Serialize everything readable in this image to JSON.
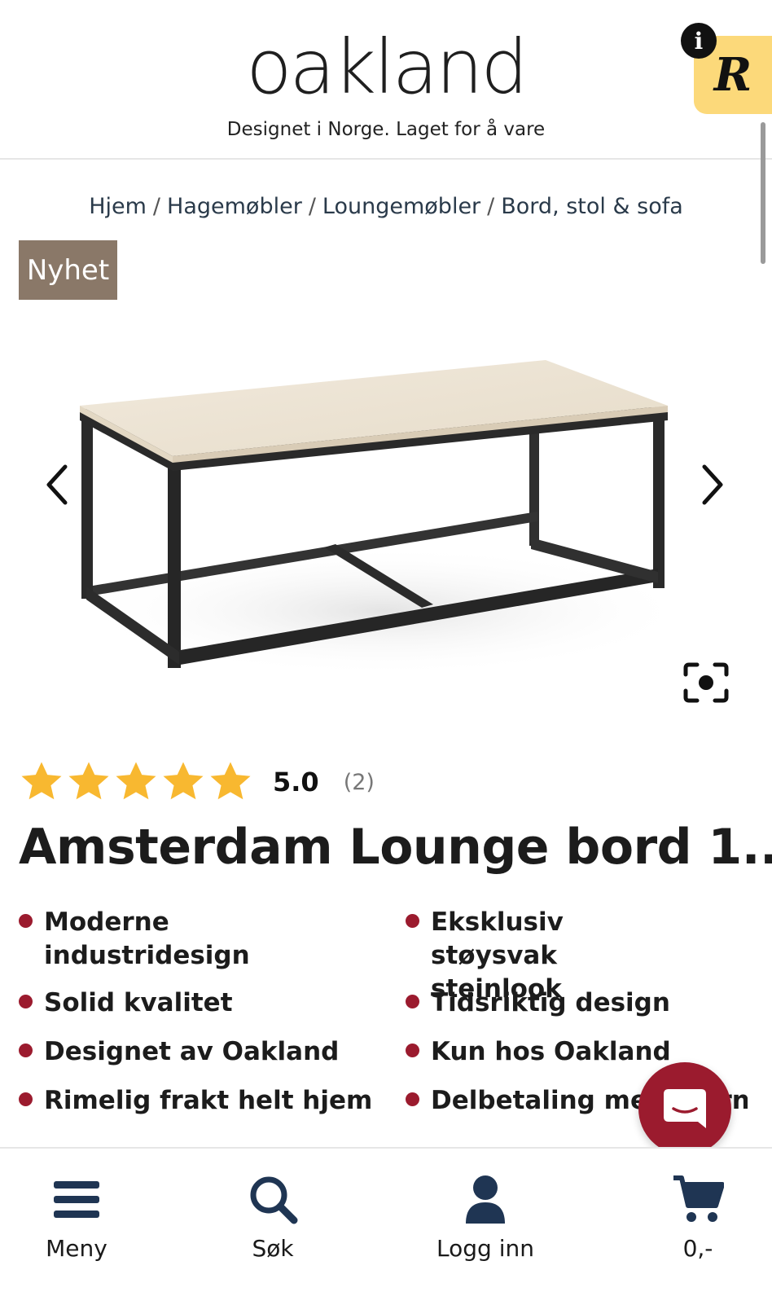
{
  "header": {
    "logo": "oakland",
    "tagline": "Designet i Norge. Laget for å vare",
    "r_badge": "R",
    "info_badge": "i",
    "brand_color": "#9b1b2e"
  },
  "breadcrumb": {
    "items": [
      "Hjem",
      "Hagemøbler",
      "Loungemøbler",
      "Bord, stol & sofa"
    ],
    "separator": "/"
  },
  "product": {
    "badge": "Nyhet",
    "rating": {
      "stars": 5,
      "value": "5.0",
      "count": "(2)"
    },
    "title": "Amsterdam Lounge bord 1...",
    "features_left": [
      "Moderne industridesign",
      "Solid kvalitet",
      "Designet av Oakland",
      "Rimelig frakt helt hjem"
    ],
    "features_right": [
      "Eksklusiv støysvak steinlook",
      "Tidsriktig design",
      "Kun hos Oakland",
      "Delbetaling med Klarna"
    ]
  },
  "icons": {
    "prev": "chevron-left-icon",
    "next": "chevron-right-icon",
    "fullscreen": "fullscreen-icon",
    "chat": "chat-icon"
  },
  "bottom_nav": {
    "menu": "Meny",
    "search": "Søk",
    "login": "Logg inn",
    "cart": "0,-"
  }
}
